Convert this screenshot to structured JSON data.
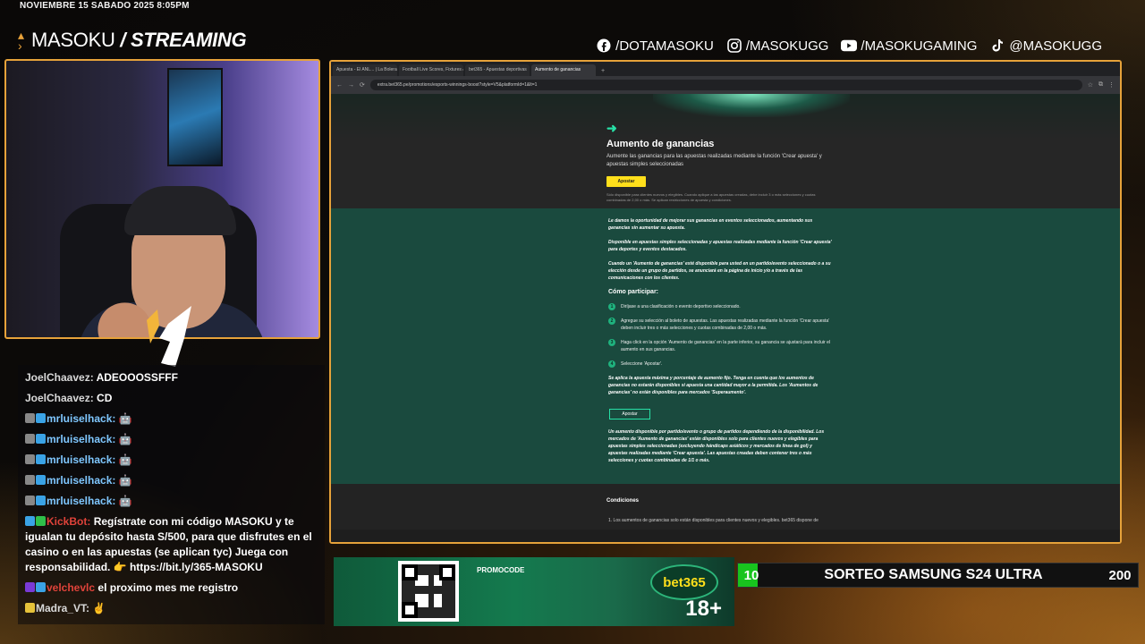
{
  "overlay": {
    "datetime": "NOVIEMBRE 15 SABADO 2025 8:05PM",
    "brand_name": "MASOKU",
    "brand_suffix": "STREAMING",
    "socials": [
      {
        "icon": "facebook-icon",
        "handle": "/DOTAMASOKU"
      },
      {
        "icon": "instagram-icon",
        "handle": "/MASOKUGG"
      },
      {
        "icon": "youtube-icon",
        "handle": "/MASOKUGAMING"
      },
      {
        "icon": "tiktok-icon",
        "handle": "@MASOKUGG"
      }
    ],
    "accent_color": "#e6a23a"
  },
  "chat": [
    {
      "user": "JoelChaavez:",
      "text": "ADEOOOSSFFF",
      "style": "plain"
    },
    {
      "user": "JoelChaavez:",
      "text": "CD",
      "style": "plain"
    },
    {
      "user": "mrluiselhack:",
      "text": "",
      "style": "cyan"
    },
    {
      "user": "mrluiselhack:",
      "text": "",
      "style": "cyan"
    },
    {
      "user": "mrluiselhack:",
      "text": "",
      "style": "cyan"
    },
    {
      "user": "mrluiselhack:",
      "text": "",
      "style": "cyan"
    },
    {
      "user": "mrluiselhack:",
      "text": "",
      "style": "cyan"
    },
    {
      "user": "KickBot:",
      "text": "Regístrate con mi código MASOKU y te igualan tu depósito hasta S/500, para que disfrutes en el casino o en las apuestas (se aplican tyc) Juega con responsabilidad. 👉 https://bit.ly/365-MASOKU",
      "style": "red"
    },
    {
      "user": "velchevlc",
      "text": "el proximo mes me registro",
      "style": "red"
    },
    {
      "user": "Madra_VT:",
      "text": "",
      "style": "plain"
    }
  ],
  "browser": {
    "tabs": [
      "Apuesta - El ANL... | La Bolera de la...",
      "Football Live Scores, Fixtures &",
      "bet365 - Apuestas deportivas",
      "Aumento de ganancias"
    ],
    "active_tab": 3,
    "url": "extra.bet365.pe/promotions/esports-winnings-boost?style=V5&platformId=1&lt=1",
    "page": {
      "title": "Aumento de ganancias",
      "subtitle": "Aumente las ganancias para las apuestas realizadas mediante la función 'Crear apuesta' y apuestas simples seleccionadas",
      "apostar_label": "Apostar",
      "fine_print": "Sólo disponible para clientes nuevos y elegibles. Cuando aplique a las apuestas creadas, debe incluir 3 o más selecciones y cuotas combinadas de 2,00 o más. Se aplican restricciones de apuesta y condiciones.",
      "intro_1": "Le damos la oportunidad de mejorar sus ganancias en eventos seleccionados, aumentando sus ganancias sin aumentar su apuesta.",
      "intro_2": "Disponible en apuestas simples seleccionadas y apuestas realizadas mediante la función 'Crear apuesta' para deportes y eventos destacados.",
      "intro_3": "Cuando un 'Aumento de ganancias' esté disponible para usted en un partido/evento seleccionado o a su elección desde un grupo de partidos, se anunciará en la página de inicio y/o a través de las comunicaciones con los clientes.",
      "how_title": "Cómo participar:",
      "steps": [
        "Diríjase a una clasificación o evento deportivo seleccionado.",
        "Agregue su selección al boleto de apuestas. Las apuestas realizadas mediante la función 'Crear apuesta' deben incluir tres o más selecciones y cuotas combinadas de 2,00 o más.",
        "Haga click en la opción 'Aumento de ganancias' en la parte inferior, su ganancia se ajustará para incluir el aumento en sus ganancias.",
        "Seleccione 'Apostar'."
      ],
      "note": "Se aplica la apuesta máxima y porcentaje de aumento fijo. Tenga en cuenta que los aumentos de ganancias no estarán disponibles si apuesta una cantidad mayor a la permitida. Los 'Aumentos de ganancias' no están disponibles para mercados 'Superaumento'.",
      "apostar_outline_label": "Apostar",
      "outro": "Un aumento disponible por partido/evento o grupo de partidos dependiendo de la disponibilidad. Los mercados de 'Aumento de ganancias' están disponibles solo para clientes nuevos y elegibles para apuestas simples seleccionadas (excluyendo hándicaps asiáticos y mercados de línea de gol) y apuestas realizadas mediante 'Crear apuesta'. Las apuestas creadas deben contener tres o más selecciones y cuotas combinadas de 1/1 o más.",
      "conditions_title": "Condiciones",
      "condition_1": "1. Los aumentos de ganancias solo están disponibles para clientes nuevos y elegibles. bet365 dispone de",
      "accent_color": "#27e0a6",
      "button_color": "#ffdf1b"
    }
  },
  "banner": {
    "label": "PROMOCODE",
    "logo": "bet365",
    "age": "18+"
  },
  "sorteo": {
    "current": "10",
    "title": "SORTEO SAMSUNG S24 ULTRA",
    "goal": "200",
    "progress_fraction": 0.05,
    "bar_color": "#18c41e"
  }
}
